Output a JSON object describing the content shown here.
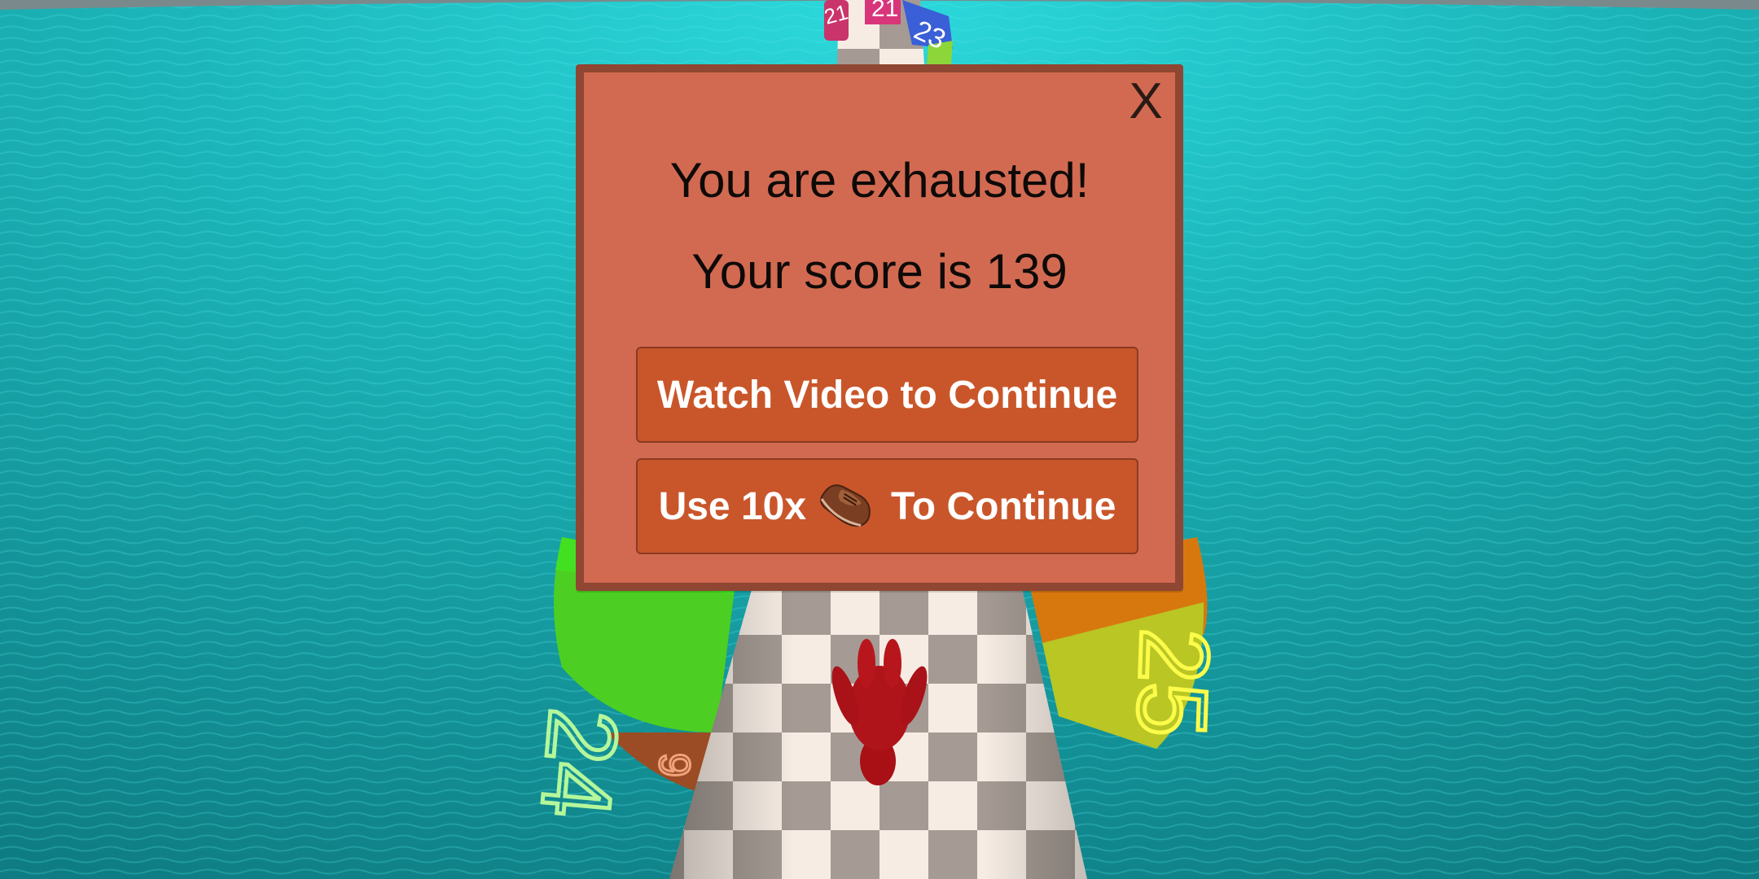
{
  "dialog": {
    "close_label": "X",
    "title": "You are exhausted!",
    "score_line": "Your score is 139",
    "watch_button": "Watch Video to Continue",
    "use_button_prefix": "Use 10x",
    "use_button_icon": "shoe-icon",
    "use_button_suffix": "To Continue"
  },
  "scene": {
    "front_left_number": "24",
    "front_right_number": "25",
    "small_left_number": "9",
    "far_numbers": [
      "21",
      "21",
      "23"
    ]
  },
  "colors": {
    "water": "#1aa6a9",
    "dialog_bg": "#d26a52",
    "dialog_border": "#8f4632",
    "button_bg": "#c9562a",
    "button_text": "#ffffff"
  }
}
